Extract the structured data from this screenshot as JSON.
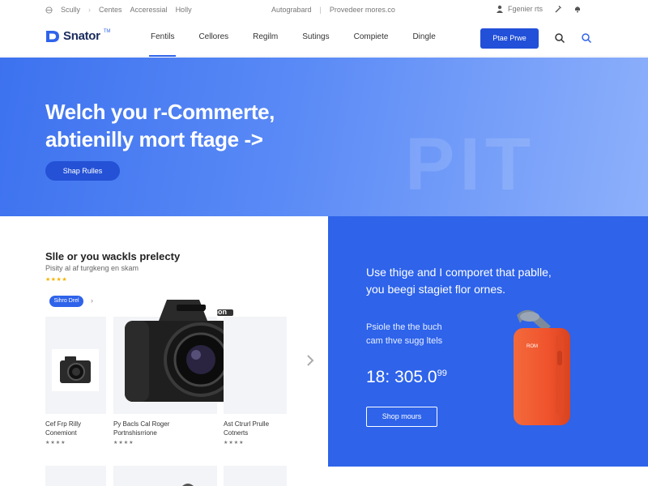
{
  "utility": {
    "left": [
      "Scully",
      "Centes",
      "Acceressial",
      "Holly"
    ],
    "middle": [
      "Autograbard",
      "Provedeer mores.co"
    ],
    "account": "Fgenier rts"
  },
  "header": {
    "logo": "Snator",
    "logo_tm": "TM",
    "nav": [
      "Fentils",
      "Cellores",
      "Regilm",
      "Sutings",
      "Compiete",
      "Dingle"
    ],
    "cta": "Ptae Prwe"
  },
  "hero": {
    "title_line1": "Welch you r-Commerte,",
    "title_line2": "abtienilly mort ftage ->",
    "button": "Shap Rulles",
    "watermark": "PIT"
  },
  "section": {
    "title": "Slle or you wackls prelecty",
    "subtitle": "Pisity al af turgkeng en skam",
    "stars": "★★★★",
    "tag": "Sihro Drel",
    "chevron": "›"
  },
  "products": [
    {
      "title": "Cef Frp Rilly",
      "subtitle": "Conemiont",
      "stars": "★★★★"
    },
    {
      "title": "Py Bacls Cal Roger",
      "subtitle": "Portnshisrrione",
      "stars": "★★★★"
    },
    {
      "title": "Ast Ctrurl Prulle",
      "subtitle": "Cotnerts",
      "stars": "★★★★"
    }
  ],
  "camera_badge": "Canon",
  "promo": {
    "title_line1": "Use thige and I comporet that pablle,",
    "title_line2": "you beegi stagiet flor ornes.",
    "sub_line1": "Psiole the the buch",
    "sub_line2": "cam thve sugg ltels",
    "price": "18: 305.0",
    "price_cents": "99",
    "button": "Shop mours",
    "suitcase_tag": "ROM"
  },
  "colors": {
    "brand": "#2f63ea",
    "hero_start": "#3d72ef",
    "hero_end": "#8db0fb",
    "promo_bg": "#2e63ea",
    "suitcase": "#f0532d"
  },
  "icons": [
    "user-icon",
    "wrench-icon",
    "bell-icon",
    "search-icon",
    "camera-icon",
    "gamepad-icon",
    "suitcase-icon",
    "chevron-right-icon"
  ]
}
